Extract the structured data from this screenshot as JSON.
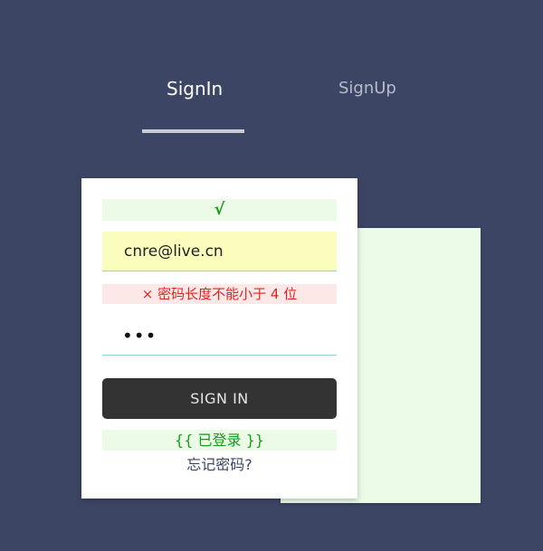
{
  "tabs": {
    "signin_label": "SignIn",
    "signup_label": "SignUp"
  },
  "form": {
    "email_status": "√",
    "email_value": "cnre@live.cn",
    "password_error": "× 密码长度不能小于 4 位",
    "password_value": "•••",
    "submit_label": "SIGN IN",
    "login_status": "{{ 已登录 }}",
    "forgot_label": "忘记密码?"
  },
  "colors": {
    "background": "#3d4565",
    "success": "#1a9a1a",
    "error": "#e8201c",
    "button": "#333333"
  }
}
